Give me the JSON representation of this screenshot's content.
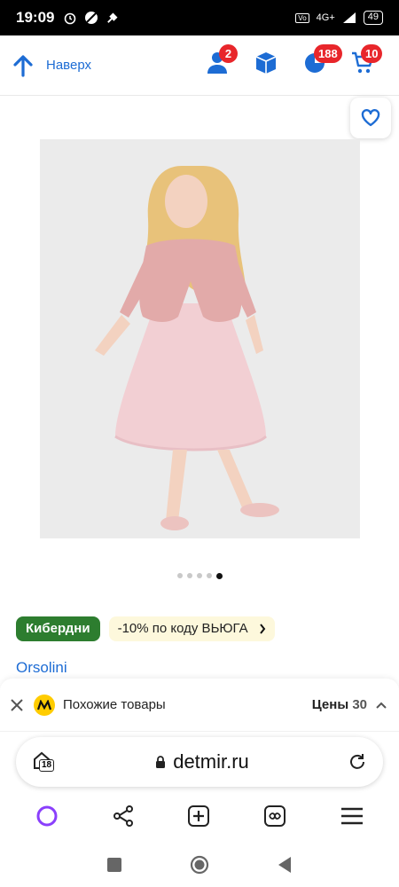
{
  "status": {
    "time": "19:09",
    "network": "4G+",
    "battery": "49"
  },
  "header": {
    "back_label": "Наверх",
    "profile_badge": "2",
    "bonus_badge": "188",
    "cart_badge": "10",
    "accent": "#1d6cd4",
    "badge_color": "#e8262b"
  },
  "promo": {
    "tag": "Кибердни",
    "offer": "-10% по коду ВЬЮГА"
  },
  "product": {
    "brand": "Orsolini"
  },
  "similar": {
    "title": "Похожие товары",
    "prices_label": "Цены",
    "prices_count": "30"
  },
  "browser": {
    "domain": "detmir.ru",
    "age_badge": "18"
  },
  "carousel": {
    "total": 5,
    "active": 5
  }
}
